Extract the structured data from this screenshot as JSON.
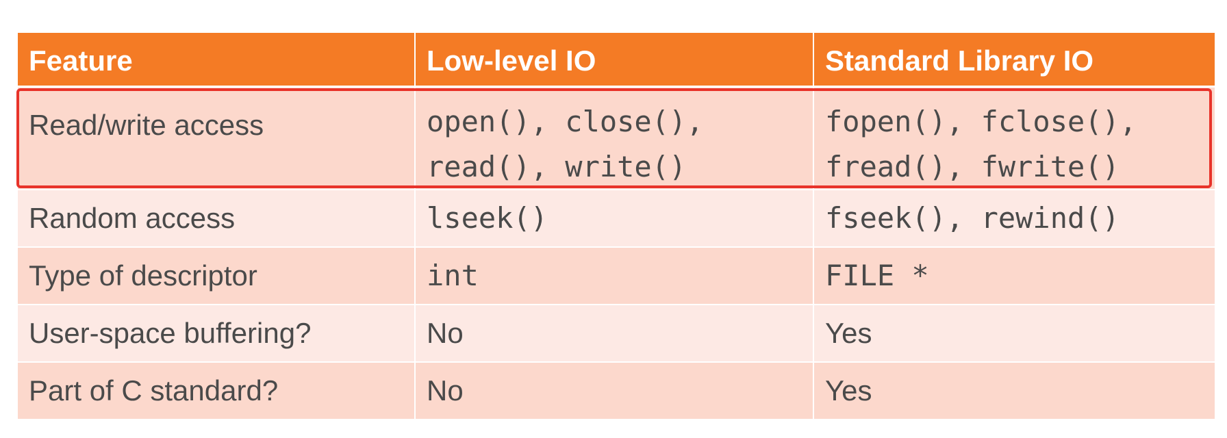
{
  "table": {
    "headers": [
      "Feature",
      "Low-level IO",
      "Standard Library IO"
    ],
    "rows": [
      {
        "feature": "Read/write access",
        "low_level": [
          "open(), close(),",
          "read(), write()"
        ],
        "stdlib": [
          "fopen(), fclose(),",
          "fread(), fwrite()"
        ]
      },
      {
        "feature": "Random access",
        "low_level": "lseek()",
        "stdlib": "fseek(), rewind()"
      },
      {
        "feature": "Type of descriptor",
        "low_level": "int",
        "stdlib": "FILE *"
      },
      {
        "feature": "User-space buffering?",
        "low_level": "No",
        "stdlib": "Yes"
      },
      {
        "feature": "Part of C standard?",
        "low_level": "No",
        "stdlib": "Yes"
      }
    ]
  },
  "colors": {
    "header_bg": "#f47b25",
    "row_dark": "#fcd8cc",
    "row_light": "#fde9e4",
    "highlight_border": "#e8332a"
  }
}
